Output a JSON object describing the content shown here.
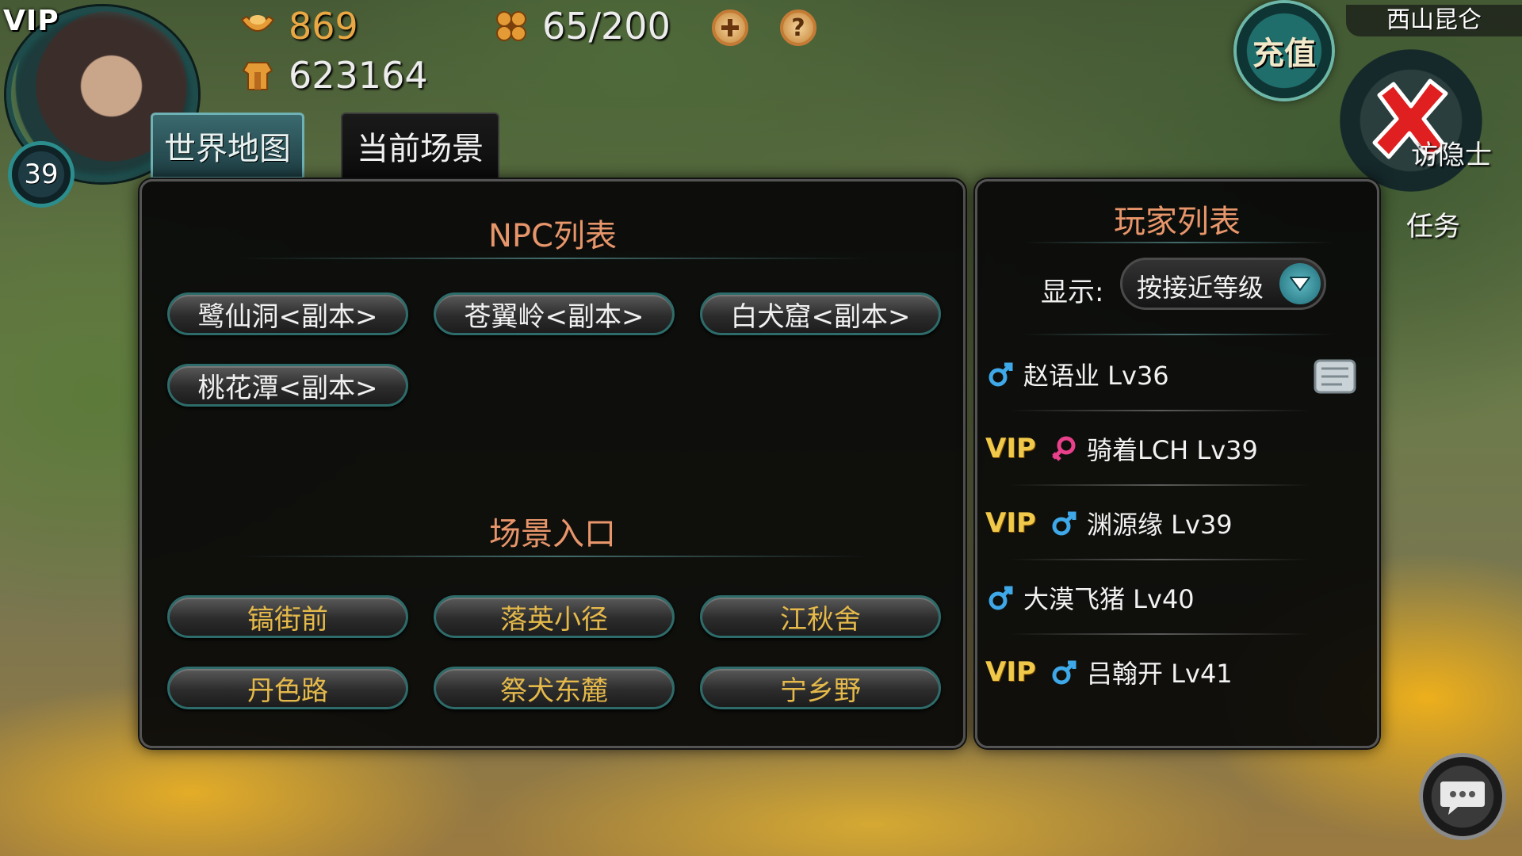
{
  "hud": {
    "vip_label": "VIP",
    "level": "39",
    "ingot": "869",
    "combat_power": "623164",
    "energy": "65/200",
    "plus_icon": "plus-icon",
    "help_label": "?"
  },
  "top_right": {
    "recharge_label": "充值",
    "location": "西山昆仑",
    "hermit_label": "访隐士",
    "task_label": "任务"
  },
  "tabs": [
    {
      "label": "世界地图",
      "active": true
    },
    {
      "label": "当前场景",
      "active": false
    }
  ],
  "npc_section": {
    "title": "NPC列表",
    "items": [
      "鹭仙洞<副本>",
      "苍翼岭<副本>",
      "白犬窟<副本>",
      "桃花潭<副本>"
    ]
  },
  "scene_section": {
    "title": "场景入口",
    "items": [
      "镐街前",
      "落英小径",
      "江秋舍",
      "丹色路",
      "祭犬东麓",
      "宁乡野"
    ]
  },
  "player_panel": {
    "title": "玩家列表",
    "display_label": "显示:",
    "sort_selected": "按接近等级",
    "players": [
      {
        "vip": "",
        "gender": "male",
        "name": "赵语业 Lv36"
      },
      {
        "vip": "VIP",
        "gender": "female",
        "name": "骑着LCH Lv39"
      },
      {
        "vip": "VIP",
        "gender": "male",
        "name": "渊源缘 Lv39"
      },
      {
        "vip": "",
        "gender": "male",
        "name": "大漠飞猪 Lv40"
      },
      {
        "vip": "VIP",
        "gender": "male",
        "name": "吕翰开 Lv41"
      }
    ]
  },
  "colors": {
    "section_title": "#e7956a",
    "scene_button_text": "#e5b94a",
    "vip_gold": "#f0c84a",
    "male_icon": "#3fa8e8",
    "female_icon": "#e8408a",
    "close_red": "#e02020"
  }
}
